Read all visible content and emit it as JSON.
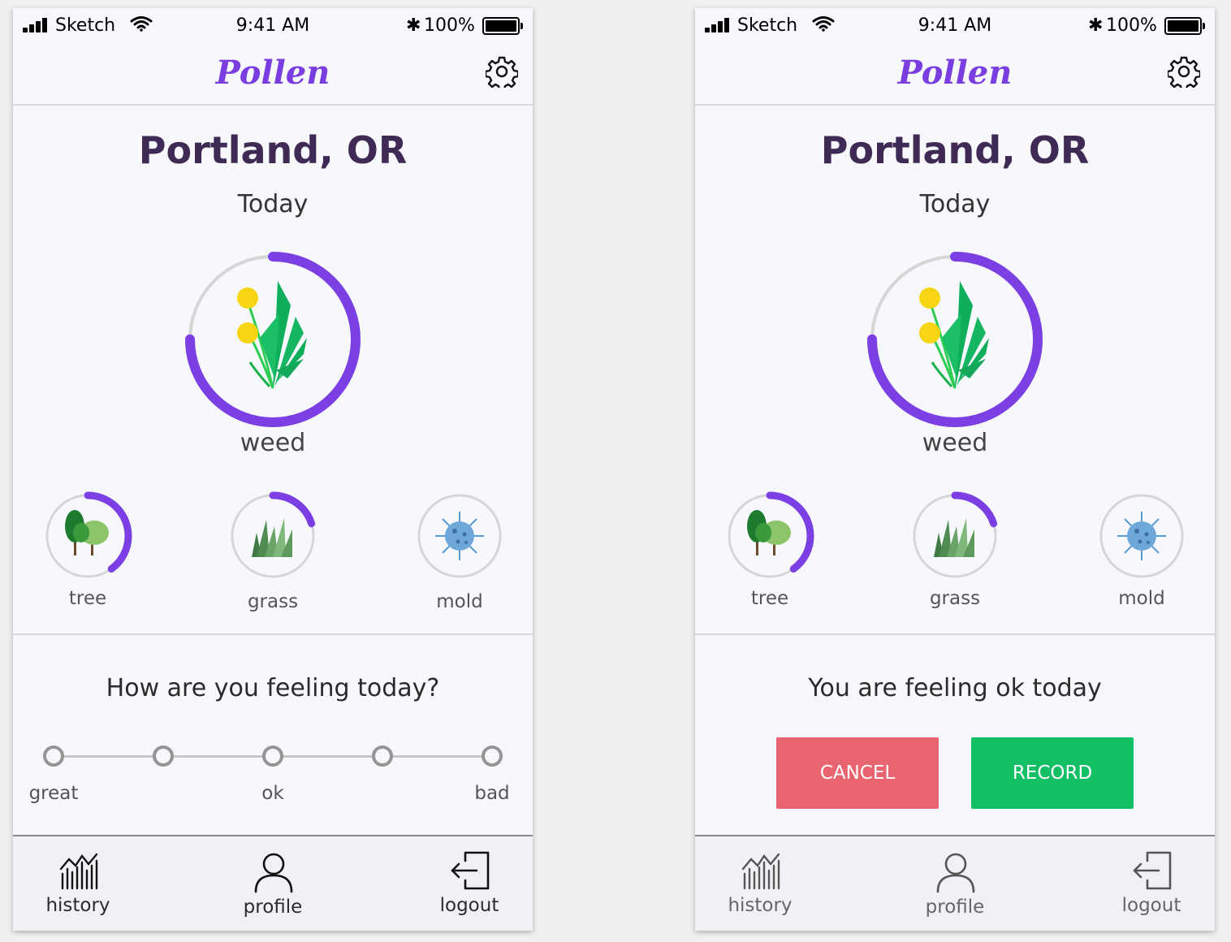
{
  "status_bar": {
    "carrier": "Sketch",
    "time": "9:41 AM",
    "bluetooth": "✱",
    "battery": "100%"
  },
  "app": {
    "logo": "Pollen"
  },
  "location": {
    "city": "Portland, OR",
    "day": "Today"
  },
  "primary_allergen": {
    "label": "weed",
    "level": 0.75
  },
  "allergens": [
    {
      "label": "tree",
      "level": 0.4
    },
    {
      "label": "grass",
      "level": 0.2
    },
    {
      "label": "mold",
      "level": 0
    }
  ],
  "feeling_prompt": {
    "question": "How are you feeling today?",
    "scale_labels": [
      "great",
      "ok",
      "bad"
    ]
  },
  "feeling_confirm": {
    "message": "You are feeling ok today",
    "cancel_label": "CANCEL",
    "record_label": "RECORD"
  },
  "tabs": [
    {
      "label": "history"
    },
    {
      "label": "profile"
    },
    {
      "label": "logout"
    }
  ],
  "colors": {
    "accent": "#7b3fe4",
    "ring_bg": "#d6d6d6",
    "cancel": "#e86470",
    "record": "#12bf64",
    "title": "#3f2a55"
  },
  "icons": {
    "weed": "dandelion-icon",
    "tree": "tree-icon",
    "grass": "grass-icon",
    "mold": "mold-spore-icon"
  }
}
